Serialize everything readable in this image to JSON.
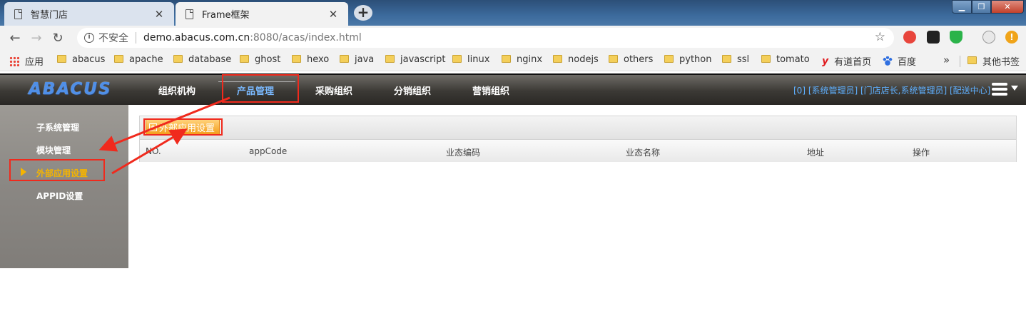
{
  "browser": {
    "tabs": [
      {
        "title": "智慧门店",
        "close": "✕"
      },
      {
        "title": "Frame框架",
        "close": "✕"
      }
    ],
    "new_tab": "+",
    "window_controls": {
      "minimize": "▁",
      "maximize": "❐",
      "close": "✕"
    },
    "nav": {
      "back": "←",
      "forward": "→",
      "reload": "↻"
    },
    "address": {
      "insecure_label": "不安全",
      "host": "demo.abacus.com.cn",
      "path": ":8080/acas/index.html"
    },
    "star": "☆",
    "bookmarks": [
      {
        "label": "应用",
        "icon": "apps-icon"
      },
      {
        "label": "abacus",
        "icon": "folder-icon"
      },
      {
        "label": "apache",
        "icon": "folder-icon"
      },
      {
        "label": "database",
        "icon": "folder-icon"
      },
      {
        "label": "ghost",
        "icon": "folder-icon"
      },
      {
        "label": "hexo",
        "icon": "folder-icon"
      },
      {
        "label": "java",
        "icon": "folder-icon"
      },
      {
        "label": "javascript",
        "icon": "folder-icon"
      },
      {
        "label": "linux",
        "icon": "folder-icon"
      },
      {
        "label": "nginx",
        "icon": "folder-icon"
      },
      {
        "label": "nodejs",
        "icon": "folder-icon"
      },
      {
        "label": "others",
        "icon": "folder-icon"
      },
      {
        "label": "python",
        "icon": "folder-icon"
      },
      {
        "label": "ssl",
        "icon": "folder-icon"
      },
      {
        "label": "tomato",
        "icon": "folder-icon"
      },
      {
        "label": "有道首页",
        "icon": "youdao-icon"
      },
      {
        "label": "百度",
        "icon": "baidu-icon"
      }
    ],
    "bookmarks_more": "»",
    "other_bookmarks": "其他书签"
  },
  "app": {
    "logo": "ABACUS",
    "topnav": [
      "组织机构",
      "产品管理",
      "采购组织",
      "分销组织",
      "营销组织"
    ],
    "active_topnav": "产品管理",
    "header_right": "[0]  [系统管理员]  [门店店长,系统管理员]  [配送中心]",
    "sidebar": [
      "子系统管理",
      "模块管理",
      "外部应用设置",
      "APPID设置"
    ],
    "active_sidebar": "外部应用设置",
    "toolbar": {
      "add_label": "外部应用设置"
    },
    "table": {
      "columns": [
        "NO.",
        "appCode",
        "业态编码",
        "业态名称",
        "地址",
        "操作"
      ]
    }
  },
  "colors": {
    "accent": "#f39b18",
    "annotation": "#f02a1d",
    "nav_active": "#7ab9ff",
    "sidebar_active": "#f5b400"
  }
}
